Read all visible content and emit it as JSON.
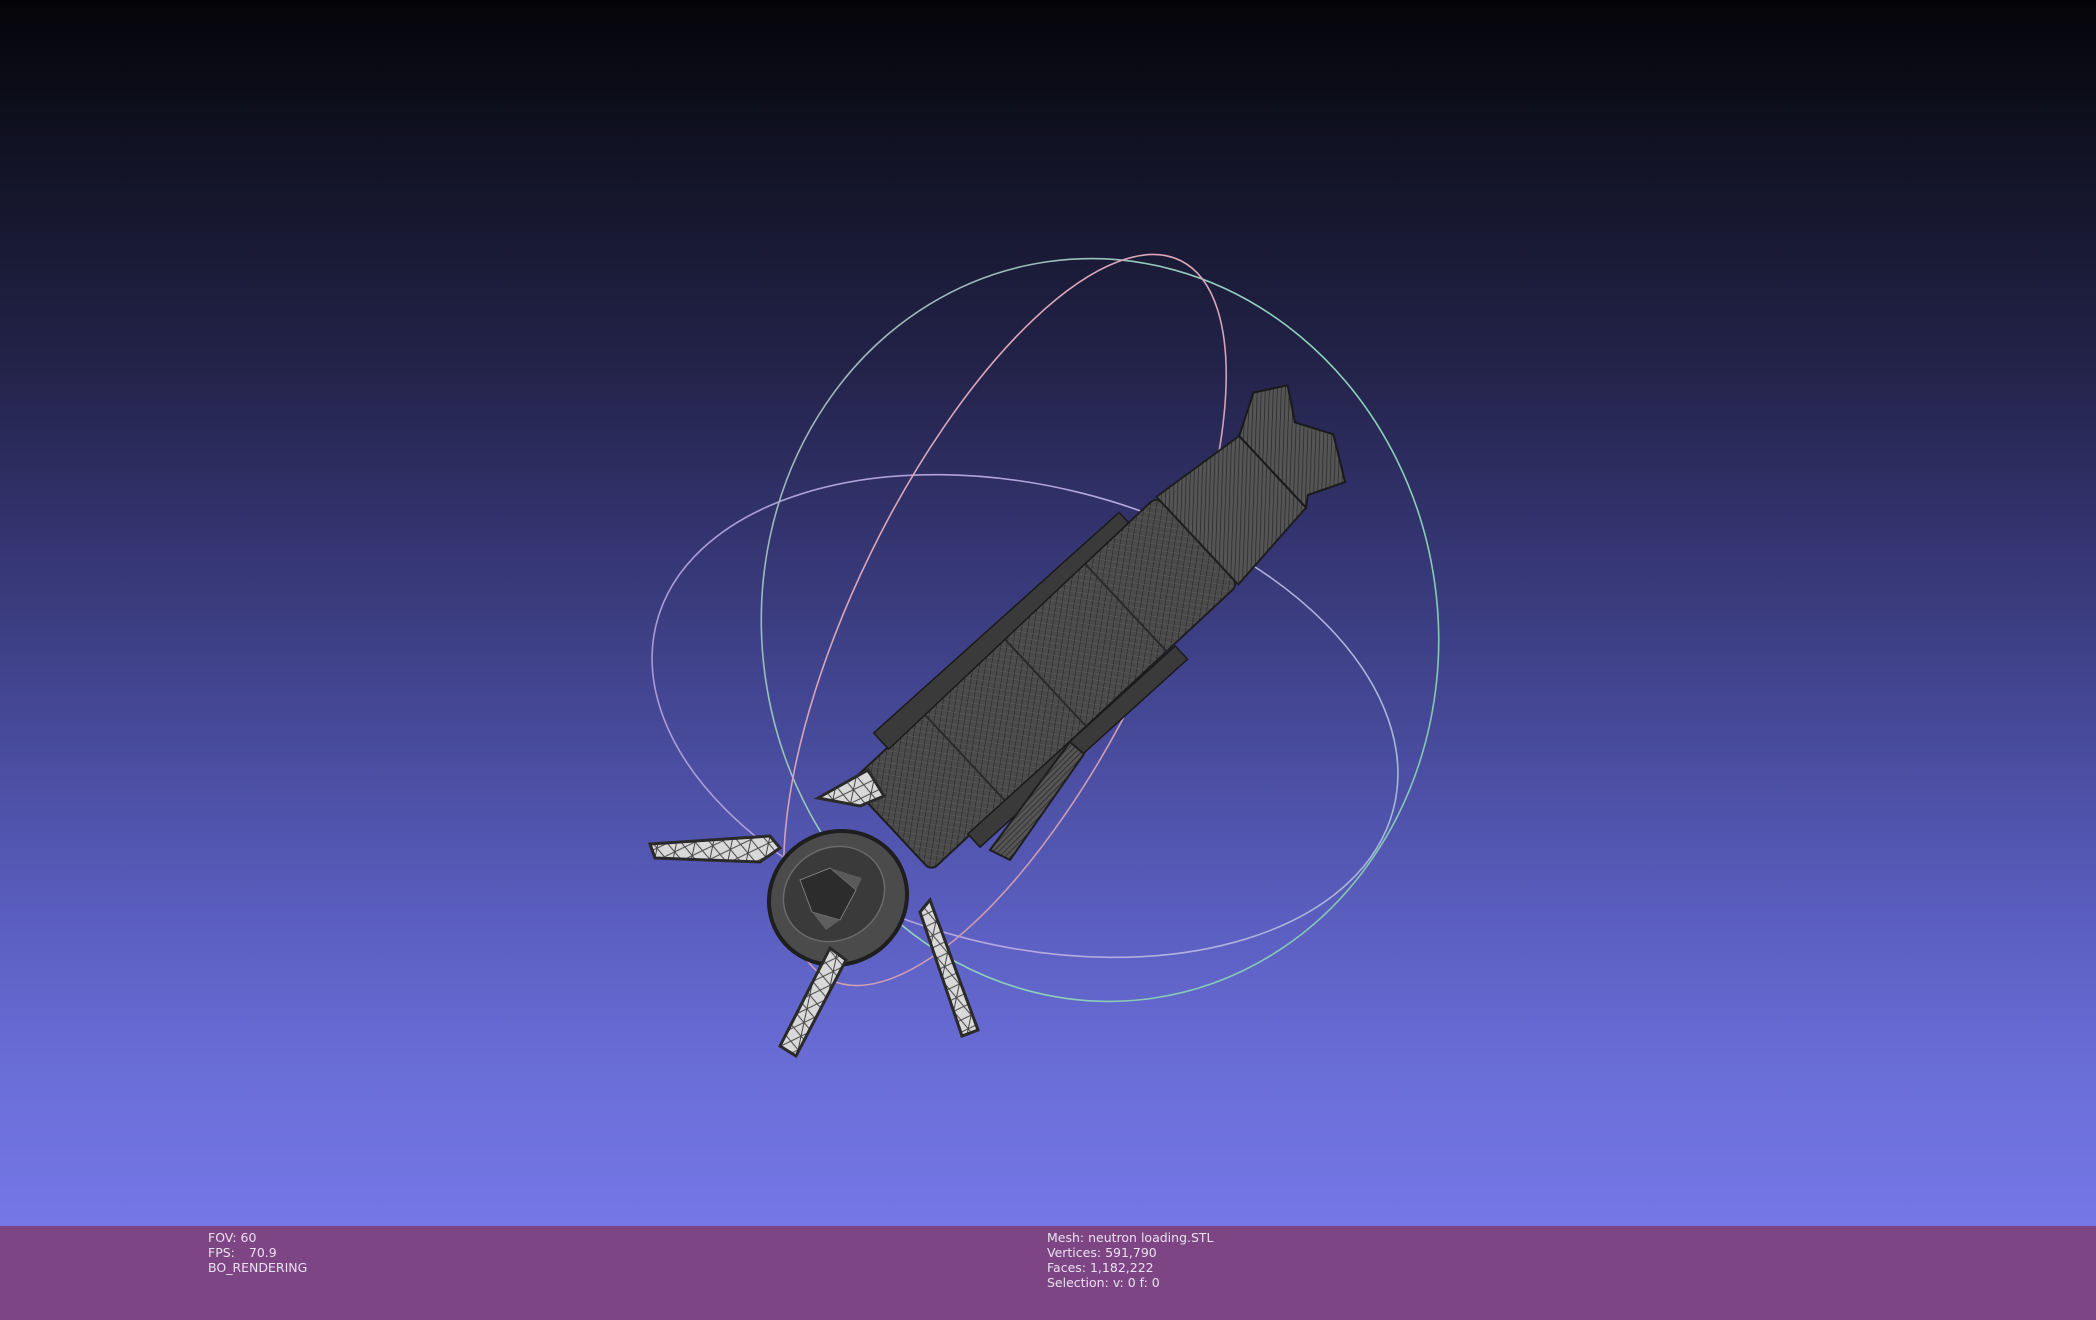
{
  "viewport": {
    "background_top": "#040408",
    "background_bottom": "#7477e6",
    "trackball_colors": {
      "green_ring": "#8ac8b4",
      "red_ring": "#d7a0b4",
      "blue_ring": "#9f92d8"
    },
    "mesh_color": "#3f3f3f"
  },
  "info_bar": {
    "background": "#7e4585",
    "left": {
      "fov_label": "FOV:",
      "fov_value": "60",
      "fps_label": "FPS:",
      "fps_value": "70.9",
      "render_mode": "BO_RENDERING"
    },
    "right": {
      "mesh_label": "Mesh:",
      "mesh_name": "neutron loading.STL",
      "vertices_label": "Vertices:",
      "vertices_value": "591,790",
      "faces_label": "Faces:",
      "faces_value": "1,182,222",
      "selection_label": "Selection:",
      "selection_value": "v: 0 f: 0"
    }
  }
}
